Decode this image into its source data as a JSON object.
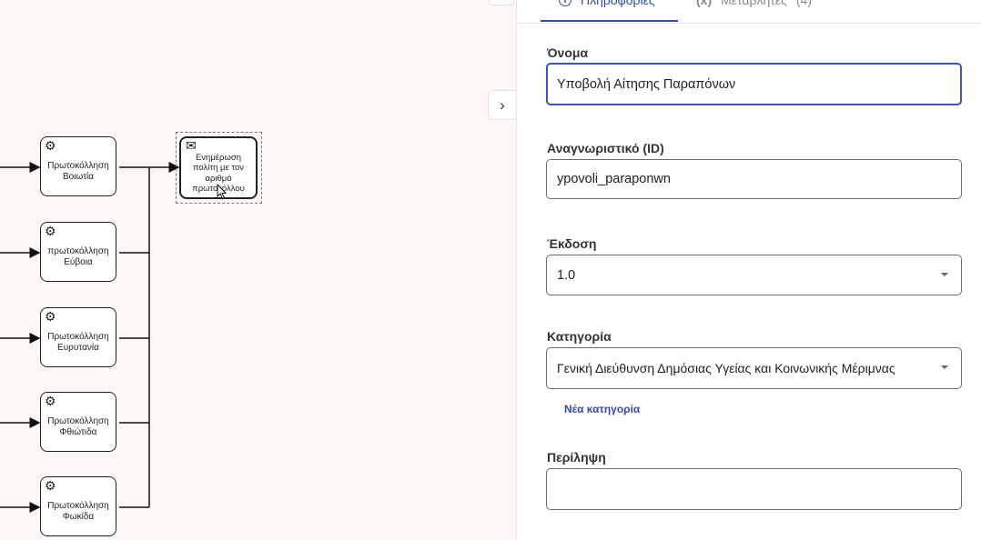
{
  "tabs": [
    {
      "label": "Πληροφορίες",
      "icon": "info-icon",
      "active": true
    },
    {
      "label": "Μεταβλητές",
      "icon": "variable-icon",
      "icon_text": "(x)",
      "count": "(4)",
      "active": false
    }
  ],
  "form": {
    "name_label": "Όνομα",
    "name_value": "Υποβολή Αίτησης Παραπόνων",
    "id_label": "Αναγνωριστικό (ID)",
    "id_value": "ypovoli_paraponwn",
    "version_label": "Έκδοση",
    "version_value": "1.0",
    "category_label": "Κατηγορία",
    "category_value": "Γενική Διεύθυνση Δημόσιας Υγείας και Κοινωνικής Μέριμνας",
    "new_category_link": "Νέα κατηγορία",
    "summary_label": "Περίληψη",
    "summary_value": ""
  },
  "diagram": {
    "service_tasks": [
      {
        "label": "Πρωτοκόλληση Βοιωτία"
      },
      {
        "label": "πρωτοκόλληση Εύβοια"
      },
      {
        "label": "Πρωτοκόλληση Ευρυτανία"
      },
      {
        "label": "Πρωτοκόλληση Φθιώτιδα"
      },
      {
        "label": "Πρωτοκόλληση Φωκίδα"
      }
    ],
    "send_task": {
      "label": "Ενημέρωση πολίτη με τον αριθμό πρωτοκόλλου"
    }
  },
  "colors": {
    "accent": "#3949ab",
    "canvas_bg": "#fdf8f5"
  }
}
